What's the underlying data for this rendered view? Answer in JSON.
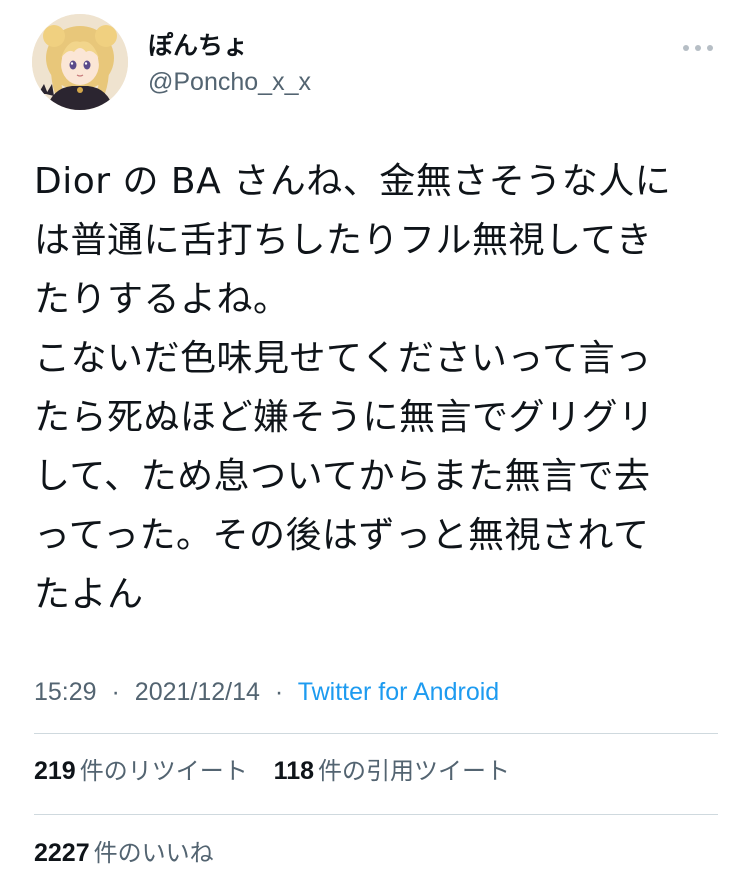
{
  "author": {
    "display_name": "ぽんちょ",
    "handle": "@Poncho_x_x",
    "avatar_icon": "anime-character-avatar"
  },
  "more_icon": "more-horizontal-icon",
  "tweet": {
    "lines": [
      "Dior の BA さんね、金無さそうな人に",
      "は普通に舌打ちしたりフル無視してき",
      "たりするよね。",
      "こないだ色味見せてくださいって言っ",
      "たら死ぬほど嫌そうに無言でグリグリ",
      "して、ため息ついてからまた無言で去",
      "ってった。その後はずっと無視されて",
      "たよん"
    ]
  },
  "meta": {
    "time": "15:29",
    "date": "2021/12/14",
    "separator": "·",
    "source": "Twitter for Android"
  },
  "stats": {
    "retweets": {
      "count": "219",
      "label": "件のリツイート"
    },
    "quotes": {
      "count": "118",
      "label": "件の引用ツイート"
    },
    "likes": {
      "count": "2227",
      "label": "件のいいね"
    }
  },
  "colors": {
    "text": "#0f1419",
    "secondary": "#536471",
    "link": "#1d9bf0",
    "divider": "#cfd9de"
  }
}
